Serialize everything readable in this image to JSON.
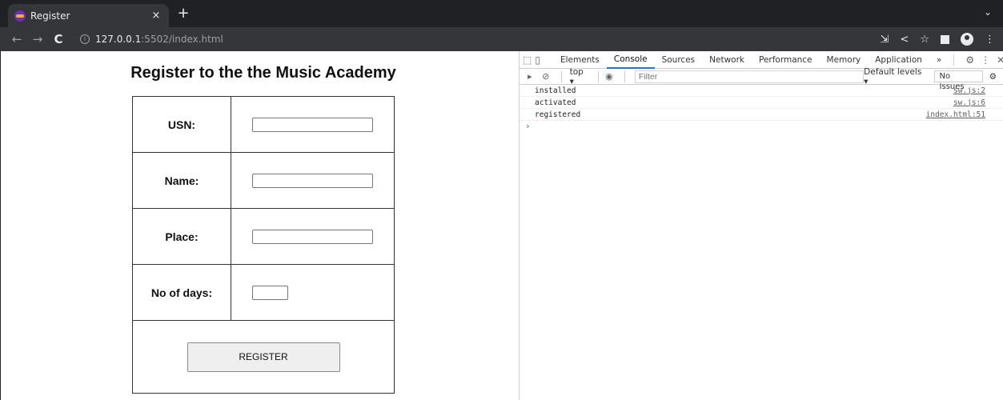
{
  "browser": {
    "tab_title": "Register",
    "tab_close": "×",
    "new_tab": "+",
    "tabbar_menu": "⌄",
    "url_host": "127.0.0.1",
    "url_rest": ":5502/index.html",
    "nav": {
      "back": "←",
      "forward": "→",
      "reload": "C"
    }
  },
  "page": {
    "title": "Register to the the Music Academy",
    "fields": [
      {
        "label": "USN:"
      },
      {
        "label": "Name:"
      },
      {
        "label": "Place:"
      },
      {
        "label": "No of days:"
      }
    ],
    "submit_label": "REGISTER"
  },
  "devtools": {
    "tabs": [
      "Elements",
      "Console",
      "Sources",
      "Network",
      "Performance",
      "Memory",
      "Application"
    ],
    "active_tab": "Console",
    "more_tabs": "»",
    "context": "top ▾",
    "filter_placeholder": "Filter",
    "default_levels": "Default levels ▾",
    "issues": "No Issues",
    "logs": [
      {
        "message": "installed",
        "source": "sw.js:2"
      },
      {
        "message": "activated",
        "source": "sw.js:6"
      },
      {
        "message": "registered",
        "source": "index.html:51"
      }
    ],
    "prompt": "›"
  }
}
